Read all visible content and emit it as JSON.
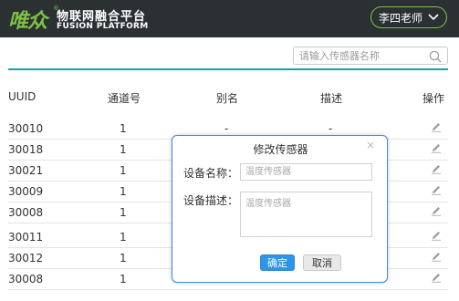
{
  "header": {
    "logo_text": "唯众",
    "logo_mark_symbol": "®",
    "brand_cn": "物联网融合平台",
    "brand_en": "FUSION PLATFORM",
    "user_name": "李四老师",
    "user_menu_icon": "chevron-down-icon"
  },
  "search": {
    "placeholder": "请输入传感器名称",
    "icon": "search-icon"
  },
  "colors": {
    "topbar_bg": "#2b3033",
    "brand_green": "#7dc243",
    "accent_teal": "#1aa0a8",
    "dialog_border": "#4a87c8",
    "primary_button": "#2f95e8"
  },
  "table": {
    "columns": [
      "UUID",
      "通道号",
      "别名",
      "描述",
      "操作"
    ],
    "rows": [
      {
        "uuid": "30010",
        "channel": "1",
        "alias": "-",
        "desc": "-"
      },
      {
        "uuid": "30018",
        "channel": "1",
        "alias": "",
        "desc": ""
      },
      {
        "uuid": "30021",
        "channel": "1",
        "alias": "",
        "desc": ""
      },
      {
        "uuid": "30009",
        "channel": "1",
        "alias": "",
        "desc": ""
      },
      {
        "uuid": "30008",
        "channel": "1",
        "alias": "",
        "desc": ""
      },
      {
        "uuid": "30011",
        "channel": "1",
        "alias": "",
        "desc": ""
      },
      {
        "uuid": "30012",
        "channel": "1",
        "alias": "",
        "desc": ""
      },
      {
        "uuid": "30008",
        "channel": "1",
        "alias": "",
        "desc": ""
      }
    ],
    "action_icon": "edit-icon"
  },
  "dialog": {
    "title": "修改传感器",
    "close_symbol": "×",
    "name_label": "设备名称：",
    "name_placeholder": "温度传感器",
    "desc_label": "设备描述：",
    "desc_placeholder": "温度传感器",
    "confirm_label": "确定",
    "cancel_label": "取消"
  }
}
